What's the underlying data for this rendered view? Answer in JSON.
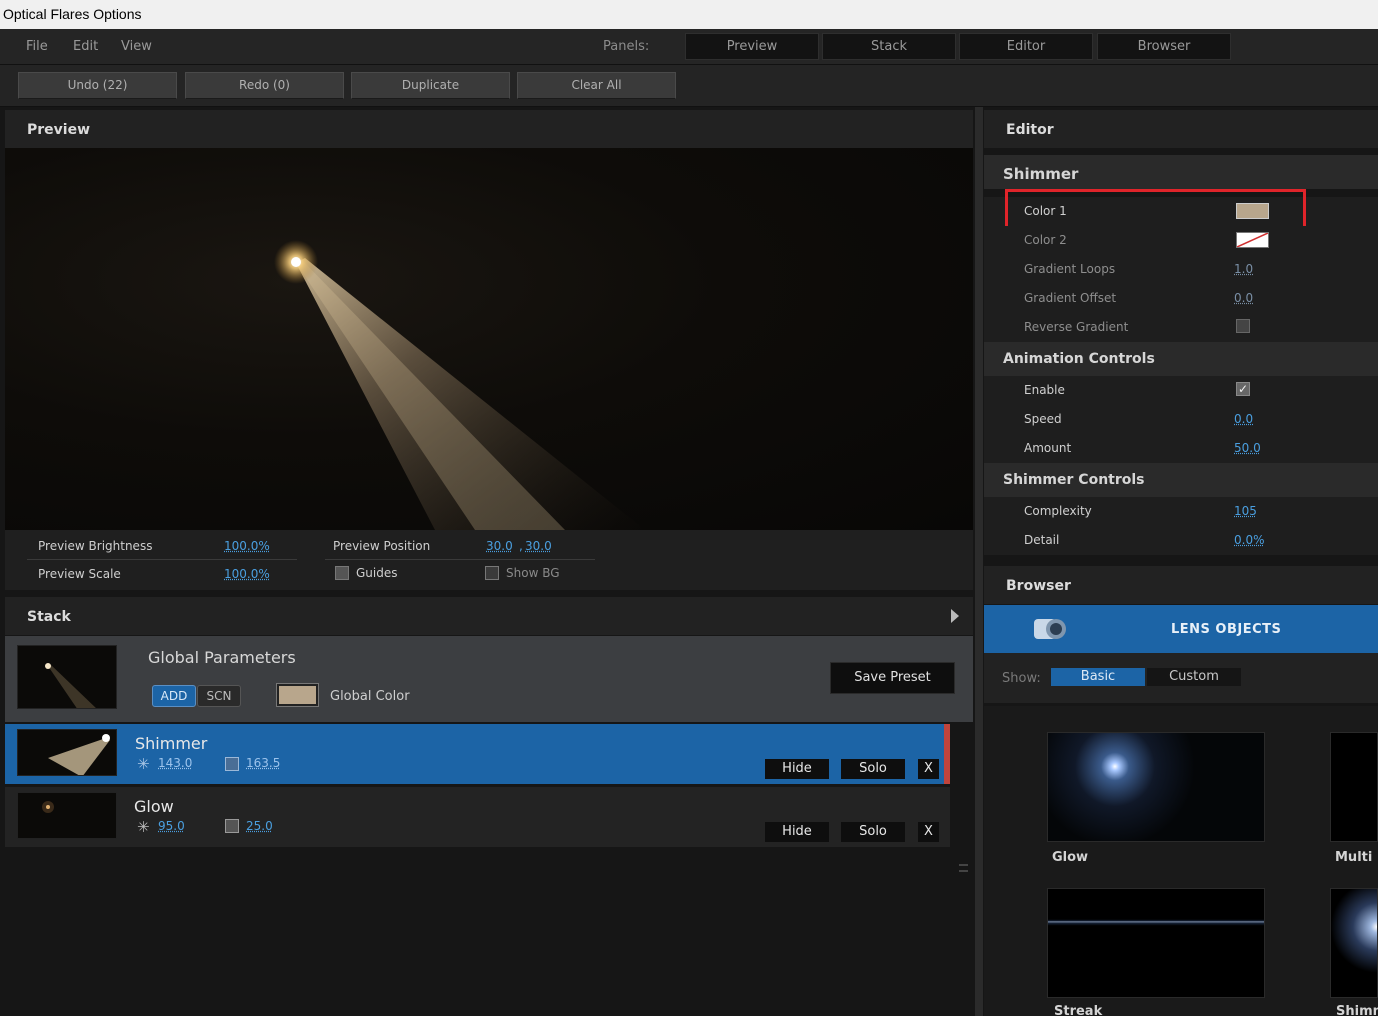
{
  "window": {
    "title": "Optical Flares Options"
  },
  "menu": {
    "file": "File",
    "edit": "Edit",
    "view": "View",
    "panels_label": "Panels:"
  },
  "panels": {
    "preview": "Preview",
    "stack": "Stack",
    "editor": "Editor",
    "browser": "Browser"
  },
  "toolbar": {
    "undo": "Undo (22)",
    "redo": "Redo (0)",
    "duplicate": "Duplicate",
    "clear_all": "Clear All"
  },
  "preview": {
    "title": "Preview",
    "brightness_label": "Preview Brightness",
    "brightness_value": "100.0%",
    "scale_label": "Preview Scale",
    "scale_value": "100.0%",
    "position_label": "Preview Position",
    "position_x": "30.0",
    "position_sep": ",",
    "position_y": "30.0",
    "guides_label": "Guides",
    "show_bg_label": "Show BG"
  },
  "stack": {
    "title": "Stack",
    "global": {
      "title": "Global Parameters",
      "add": "ADD",
      "scn": "SCN",
      "color_label": "Global Color",
      "color": "#b8a68c",
      "save_preset": "Save Preset"
    },
    "layers": [
      {
        "name": "Shimmer",
        "brightness": "143.0",
        "scale": "163.5",
        "hide": "Hide",
        "solo": "Solo",
        "remove": "X"
      },
      {
        "name": "Glow",
        "brightness": "95.0",
        "scale": "25.0",
        "hide": "Hide",
        "solo": "Solo",
        "remove": "X"
      }
    ]
  },
  "editor": {
    "title": "Editor",
    "sections": {
      "shimmer": "Shimmer",
      "animation": "Animation Controls",
      "shimmer_controls": "Shimmer Controls"
    },
    "color1_label": "Color 1",
    "color1": "#b8a68c",
    "color2_label": "Color 2",
    "gradient_loops_label": "Gradient Loops",
    "gradient_loops": "1.0",
    "gradient_offset_label": "Gradient Offset",
    "gradient_offset": "0.0",
    "reverse_gradient_label": "Reverse Gradient",
    "enable_label": "Enable",
    "speed_label": "Speed",
    "speed": "0.0",
    "amount_label": "Amount",
    "amount": "50.0",
    "complexity_label": "Complexity",
    "complexity": "105",
    "detail_label": "Detail",
    "detail": "0.0%"
  },
  "browser": {
    "title": "Browser",
    "category": "LENS OBJECTS",
    "show_label": "Show:",
    "basic": "Basic",
    "custom": "Custom",
    "items": [
      "Glow",
      "Multi Iris",
      "Streak",
      "Shimmer"
    ]
  },
  "colors": {
    "accent": "#1c64a6",
    "link": "#4a9fe0",
    "highlight": "#e0242a"
  }
}
